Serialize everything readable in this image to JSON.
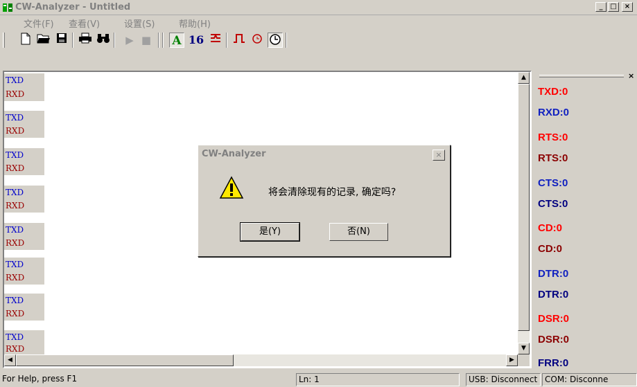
{
  "window": {
    "title": "CW-Analyzer - Untitled",
    "min": "_",
    "max": "□",
    "close": "×"
  },
  "menu": [
    "文件(F)",
    "查看(V)",
    "设置(S)",
    "帮助(H)"
  ],
  "toolbar": {
    "new": "🗋",
    "open": "📂",
    "save": "💾",
    "print": "🖶",
    "find": "👓",
    "play": "▶",
    "stop": "■",
    "ascii": "A",
    "hex": "16",
    "sig": "⩋",
    "pulse": "⎍",
    "timer": "⏰",
    "clock": "🕒"
  },
  "data_rows": [
    "TXD",
    "RXD",
    "TXD",
    "RXD",
    "TXD",
    "RXD",
    "TXD",
    "RXD",
    "TXD",
    "RXD",
    "TXD",
    "RXD",
    "TXD",
    "RXD",
    "TXD",
    "RXD"
  ],
  "signals": [
    {
      "label": "TXD:0",
      "color": "#ff0000"
    },
    {
      "label": "RXD:0",
      "color": "#1020c0"
    },
    {
      "label": "RTS:0",
      "color": "#ff0000"
    },
    {
      "label": "RTS:0",
      "color": "#8b0000"
    },
    {
      "label": "CTS:0",
      "color": "#1020c0"
    },
    {
      "label": "CTS:0",
      "color": "#000080"
    },
    {
      "label": "CD:0",
      "color": "#ff0000"
    },
    {
      "label": "CD:0",
      "color": "#8b0000"
    },
    {
      "label": "DTR:0",
      "color": "#1020c0"
    },
    {
      "label": "DTR:0",
      "color": "#000080"
    },
    {
      "label": "DSR:0",
      "color": "#ff0000"
    },
    {
      "label": "DSR:0",
      "color": "#8b0000"
    },
    {
      "label": "FRR:0",
      "color": "#000080"
    }
  ],
  "dialog": {
    "title": "CW-Analyzer",
    "close": "×",
    "message": "将会清除现有的记录, 确定吗?",
    "yes": "是(Y)",
    "no": "否(N)"
  },
  "status": {
    "help": "For Help, press F1",
    "line": "Ln: 1",
    "usb": "USB: Disconnect",
    "com": "COM: Disconne"
  }
}
